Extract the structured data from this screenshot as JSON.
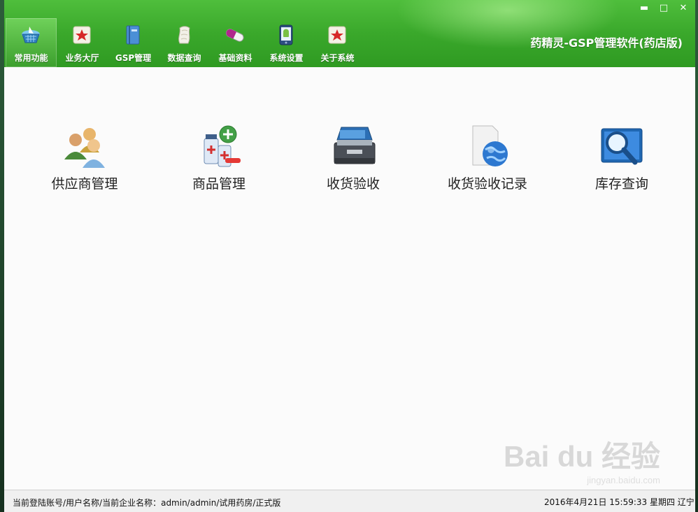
{
  "window": {
    "app_title": "药精灵-GSP管理软件(药店版)",
    "controls": [
      "▬",
      "□",
      "✕"
    ]
  },
  "nav": {
    "items": [
      {
        "label": "常用功能",
        "icon": "basket-icon",
        "active": true
      },
      {
        "label": "业务大厅",
        "icon": "star-badge-icon"
      },
      {
        "label": "GSP管理",
        "icon": "book-icon"
      },
      {
        "label": "数据查询",
        "icon": "paper-scroll-icon"
      },
      {
        "label": "基础资料",
        "icon": "capsule-icon"
      },
      {
        "label": "系统设置",
        "icon": "android-phone-icon"
      },
      {
        "label": "关于系统",
        "icon": "star-badge-icon"
      }
    ]
  },
  "tiles": [
    {
      "label": "供应商管理",
      "icon": "users-icon"
    },
    {
      "label": "商品管理",
      "icon": "medicine-bottles-icon"
    },
    {
      "label": "收货验收",
      "icon": "toolbox-icon"
    },
    {
      "label": "收货验收记录",
      "icon": "document-globe-icon"
    },
    {
      "label": "库存查询",
      "icon": "magnifier-icon"
    }
  ],
  "status": {
    "left": "当前登陆账号/用户名称/当前企业名称：admin/admin/试用药房/正式版",
    "right": "2016年4月21日 15:59:33 星期四 辽宁"
  },
  "watermark": {
    "main": "Bai du 经验",
    "sub": "jingyan.baidu.com"
  },
  "colors": {
    "header_green": "#3aa82b",
    "active_tab": "#5fc24a"
  }
}
